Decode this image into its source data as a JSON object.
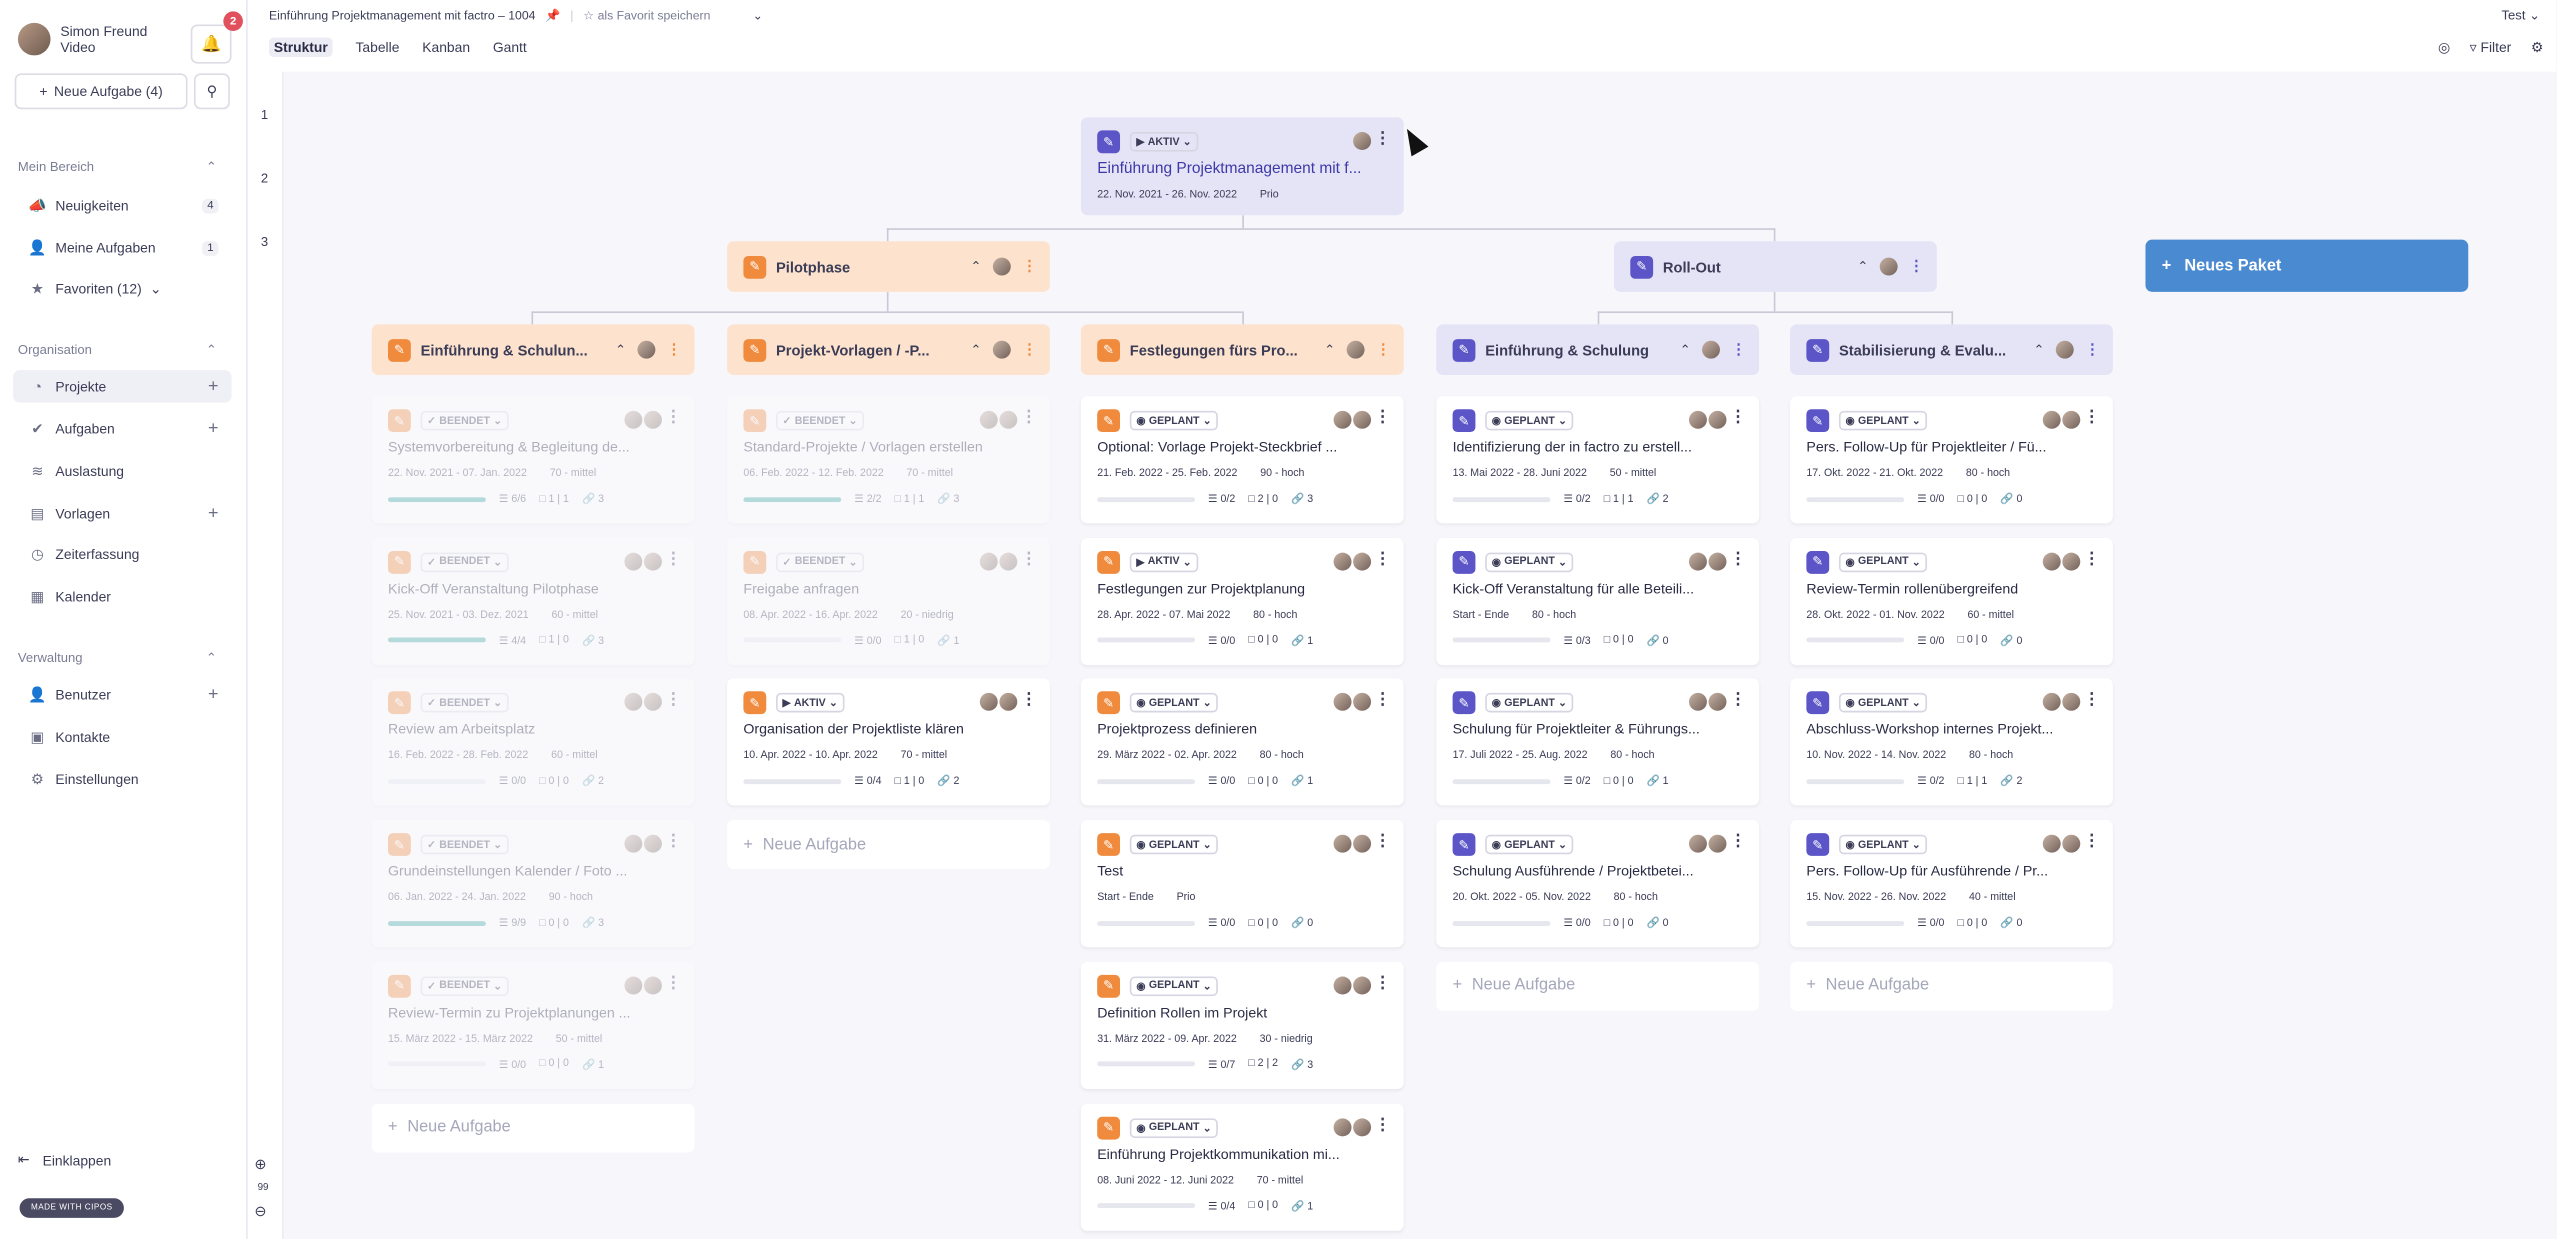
{
  "sidebar": {
    "user": {
      "name": "Simon Freund",
      "sub": "Video"
    },
    "notifications": "2",
    "new_task": "Neue Aufgabe (4)",
    "sections": {
      "mein": "Mein Bereich",
      "org": "Organisation",
      "verw": "Verwaltung"
    },
    "items": {
      "neuigkeiten": {
        "label": "Neuigkeiten",
        "count": "4"
      },
      "meine": {
        "label": "Meine Aufgaben",
        "count": "1"
      },
      "favoriten": {
        "label": "Favoriten (12)"
      },
      "projekte": {
        "label": "Projekte"
      },
      "aufgaben": {
        "label": "Aufgaben"
      },
      "auslastung": {
        "label": "Auslastung"
      },
      "vorlagen": {
        "label": "Vorlagen"
      },
      "zeiterfassung": {
        "label": "Zeiterfassung"
      },
      "kalender": {
        "label": "Kalender"
      },
      "benutzer": {
        "label": "Benutzer"
      },
      "kontakte": {
        "label": "Kontakte"
      },
      "einstellungen": {
        "label": "Einstellungen"
      }
    },
    "collapse": "Einklappen",
    "madewith": "MADE WITH CIPOS"
  },
  "top": {
    "breadcrumb": "Einführung Projektmanagement mit factro – 1004",
    "fav": "als Favorit speichern",
    "account": "Test",
    "tabs": [
      "Struktur",
      "Tabelle",
      "Kanban",
      "Gantt"
    ],
    "filter": "Filter",
    "levels": [
      "1",
      "2",
      "3"
    ],
    "zoom": "99"
  },
  "colors": {
    "orange": "#f08a3c",
    "lavender": "#5b55c7",
    "accent": "#4a8ad1"
  },
  "root": {
    "status": "AKTIV",
    "title": "Einführung Projektmanagement mit f...",
    "dates": "22. Nov. 2021 - 26. Nov. 2022",
    "prio": "Prio"
  },
  "packages": {
    "pilot": "Pilotphase",
    "rollout": "Roll-Out",
    "new": "Neues Paket"
  },
  "subs": [
    "Einführung & Schulun...",
    "Projekt-Vorlagen / -P...",
    "Festlegungen fürs Pro...",
    "Einführung & Schulung",
    "Stabilisierung & Evalu..."
  ],
  "add_task": "Neue Aufgabe",
  "cards": {
    "c1": [
      {
        "status": "BEENDET",
        "title": "Systemvorbereitung & Begleitung de...",
        "dates": "22. Nov. 2021 - 07. Jan. 2022",
        "effort": "70 - mittel",
        "todo": "6/6",
        "cm": "1 | 1",
        "lk": "3"
      },
      {
        "status": "BEENDET",
        "title": "Kick-Off Veranstaltung Pilotphase",
        "dates": "25. Nov. 2021 - 03. Dez. 2021",
        "effort": "60 - mittel",
        "todo": "4/4",
        "cm": "1 | 0",
        "lk": "3"
      },
      {
        "status": "BEENDET",
        "title": "Review am Arbeitsplatz",
        "dates": "16. Feb. 2022 - 28. Feb. 2022",
        "effort": "60 - mittel",
        "todo": "0/0",
        "cm": "0 | 0",
        "lk": "2"
      },
      {
        "status": "BEENDET",
        "title": "Grundeinstellungen Kalender / Foto ...",
        "dates": "06. Jan. 2022 - 24. Jan. 2022",
        "effort": "90 - hoch",
        "todo": "9/9",
        "cm": "0 | 0",
        "lk": "3"
      },
      {
        "status": "BEENDET",
        "title": "Review-Termin zu Projektplanungen ...",
        "dates": "15. März 2022 - 15. März 2022",
        "effort": "50 - mittel",
        "todo": "0/0",
        "cm": "0 | 0",
        "lk": "1"
      }
    ],
    "c2": [
      {
        "status": "BEENDET",
        "title": "Standard-Projekte / Vorlagen erstellen",
        "dates": "06. Feb. 2022 - 12. Feb. 2022",
        "effort": "70 - mittel",
        "todo": "2/2",
        "cm": "1 | 1",
        "lk": "3"
      },
      {
        "status": "BEENDET",
        "title": "Freigabe anfragen",
        "dates": "08. Apr. 2022 - 16. Apr. 2022",
        "effort": "20 - niedrig",
        "todo": "0/0",
        "cm": "1 | 0",
        "lk": "1"
      },
      {
        "status": "AKTIV",
        "title": "Organisation der Projektliste klären",
        "dates": "10. Apr. 2022 - 10. Apr. 2022",
        "effort": "70 - mittel",
        "todo": "0/4",
        "cm": "1 | 0",
        "lk": "2"
      }
    ],
    "c3": [
      {
        "status": "GEPLANT",
        "title": "Optional: Vorlage Projekt-Steckbrief ...",
        "dates": "21. Feb. 2022 - 25. Feb. 2022",
        "effort": "90 - hoch",
        "todo": "0/2",
        "cm": "2 | 0",
        "lk": "3"
      },
      {
        "status": "AKTIV",
        "title": "Festlegungen zur Projektplanung",
        "dates": "28. Apr. 2022 - 07. Mai 2022",
        "effort": "80 - hoch",
        "todo": "0/0",
        "cm": "0 | 0",
        "lk": "1"
      },
      {
        "status": "GEPLANT",
        "title": "Projektprozess definieren",
        "dates": "29. März 2022 - 02. Apr. 2022",
        "effort": "80 - hoch",
        "todo": "0/0",
        "cm": "0 | 0",
        "lk": "1"
      },
      {
        "status": "GEPLANT",
        "title": "Test",
        "dates": "Start - Ende",
        "effort": "Prio",
        "todo": "0/0",
        "cm": "0 | 0",
        "lk": "0"
      },
      {
        "status": "GEPLANT",
        "title": "Definition Rollen im Projekt",
        "dates": "31. März 2022 - 09. Apr. 2022",
        "effort": "30 - niedrig",
        "todo": "0/7",
        "cm": "2 | 2",
        "lk": "3"
      },
      {
        "status": "GEPLANT",
        "title": "Einführung Projektkommunikation mi...",
        "dates": "08. Juni 2022 - 12. Juni 2022",
        "effort": "70 - mittel",
        "todo": "0/4",
        "cm": "0 | 0",
        "lk": "1"
      }
    ],
    "c4": [
      {
        "status": "GEPLANT",
        "title": "Identifizierung der in factro zu erstell...",
        "dates": "13. Mai 2022 - 28. Juni 2022",
        "effort": "50 - mittel",
        "todo": "0/2",
        "cm": "1 | 1",
        "lk": "2"
      },
      {
        "status": "GEPLANT",
        "title": "Kick-Off Veranstaltung für alle Beteili...",
        "dates": "Start - Ende",
        "effort": "80 - hoch",
        "todo": "0/3",
        "cm": "0 | 0",
        "lk": "0"
      },
      {
        "status": "GEPLANT",
        "title": "Schulung für Projektleiter & Führungs...",
        "dates": "17. Juli 2022 - 25. Aug. 2022",
        "effort": "80 - hoch",
        "todo": "0/2",
        "cm": "0 | 0",
        "lk": "1"
      },
      {
        "status": "GEPLANT",
        "title": "Schulung Ausführende / Projektbetei...",
        "dates": "20. Okt. 2022 - 05. Nov. 2022",
        "effort": "80 - hoch",
        "todo": "0/0",
        "cm": "0 | 0",
        "lk": "0"
      }
    ],
    "c5": [
      {
        "status": "GEPLANT",
        "title": "Pers. Follow-Up für Projektleiter / Fü...",
        "dates": "17. Okt. 2022 - 21. Okt. 2022",
        "effort": "80 - hoch",
        "todo": "0/0",
        "cm": "0 | 0",
        "lk": "0"
      },
      {
        "status": "GEPLANT",
        "title": "Review-Termin rollenübergreifend",
        "dates": "28. Okt. 2022 - 01. Nov. 2022",
        "effort": "60 - mittel",
        "todo": "0/0",
        "cm": "0 | 0",
        "lk": "0"
      },
      {
        "status": "GEPLANT",
        "title": "Abschluss-Workshop internes Projekt...",
        "dates": "10. Nov. 2022 - 14. Nov. 2022",
        "effort": "80 - hoch",
        "todo": "0/2",
        "cm": "1 | 1",
        "lk": "2"
      },
      {
        "status": "GEPLANT",
        "title": "Pers. Follow-Up für Ausführende / Pr...",
        "dates": "15. Nov. 2022 - 26. Nov. 2022",
        "effort": "40 - mittel",
        "todo": "0/0",
        "cm": "0 | 0",
        "lk": "0"
      }
    ]
  }
}
